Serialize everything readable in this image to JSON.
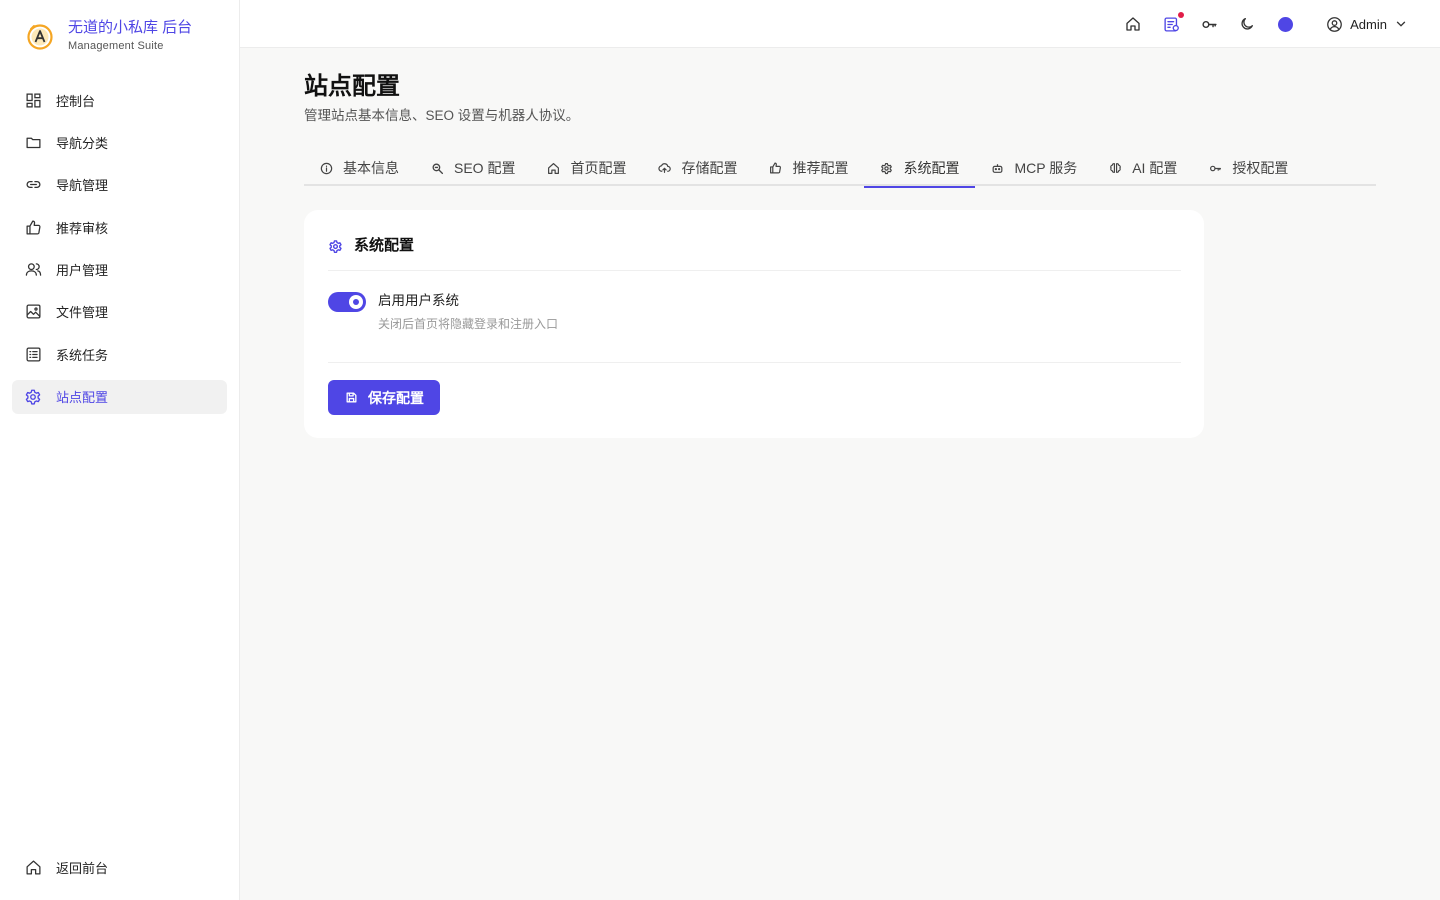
{
  "brand": {
    "title": "无道的小私库 后台",
    "subtitle": "Management Suite",
    "logo_icon": "circled-a-logo"
  },
  "sidebar": {
    "items": [
      {
        "label": "控制台",
        "icon": "dashboard-icon"
      },
      {
        "label": "导航分类",
        "icon": "folder-icon"
      },
      {
        "label": "导航管理",
        "icon": "link-icon"
      },
      {
        "label": "推荐审核",
        "icon": "thumbs-up-icon"
      },
      {
        "label": "用户管理",
        "icon": "users-icon"
      },
      {
        "label": "文件管理",
        "icon": "image-icon"
      },
      {
        "label": "系统任务",
        "icon": "list-icon"
      },
      {
        "label": "站点配置",
        "icon": "gear-icon",
        "active": true
      }
    ],
    "bottom": {
      "label": "返回前台",
      "icon": "home-icon"
    }
  },
  "topbar": {
    "icons": [
      "home-icon",
      "notifications-icon",
      "key-icon",
      "moon-icon",
      "theme-color-dot"
    ],
    "user": "Admin"
  },
  "page": {
    "title": "站点配置",
    "description": "管理站点基本信息、SEO 设置与机器人协议。"
  },
  "tabs": [
    {
      "label": "基本信息",
      "icon": "info-icon"
    },
    {
      "label": "SEO 配置",
      "icon": "search-icon"
    },
    {
      "label": "首页配置",
      "icon": "home-icon"
    },
    {
      "label": "存储配置",
      "icon": "cloud-upload-icon"
    },
    {
      "label": "推荐配置",
      "icon": "thumbs-up-icon"
    },
    {
      "label": "系统配置",
      "icon": "gear-icon",
      "active": true
    },
    {
      "label": "MCP 服务",
      "icon": "robot-icon"
    },
    {
      "label": "AI 配置",
      "icon": "brain-icon"
    },
    {
      "label": "授权配置",
      "icon": "key-icon"
    }
  ],
  "card": {
    "title": "系统配置",
    "toggle": {
      "label": "启用用户系统",
      "help": "关闭后首页将隐藏登录和注册入口",
      "enabled": true
    },
    "save_label": "保存配置"
  },
  "colors": {
    "accent": "#4f46e5",
    "notification": "#e11d48"
  }
}
